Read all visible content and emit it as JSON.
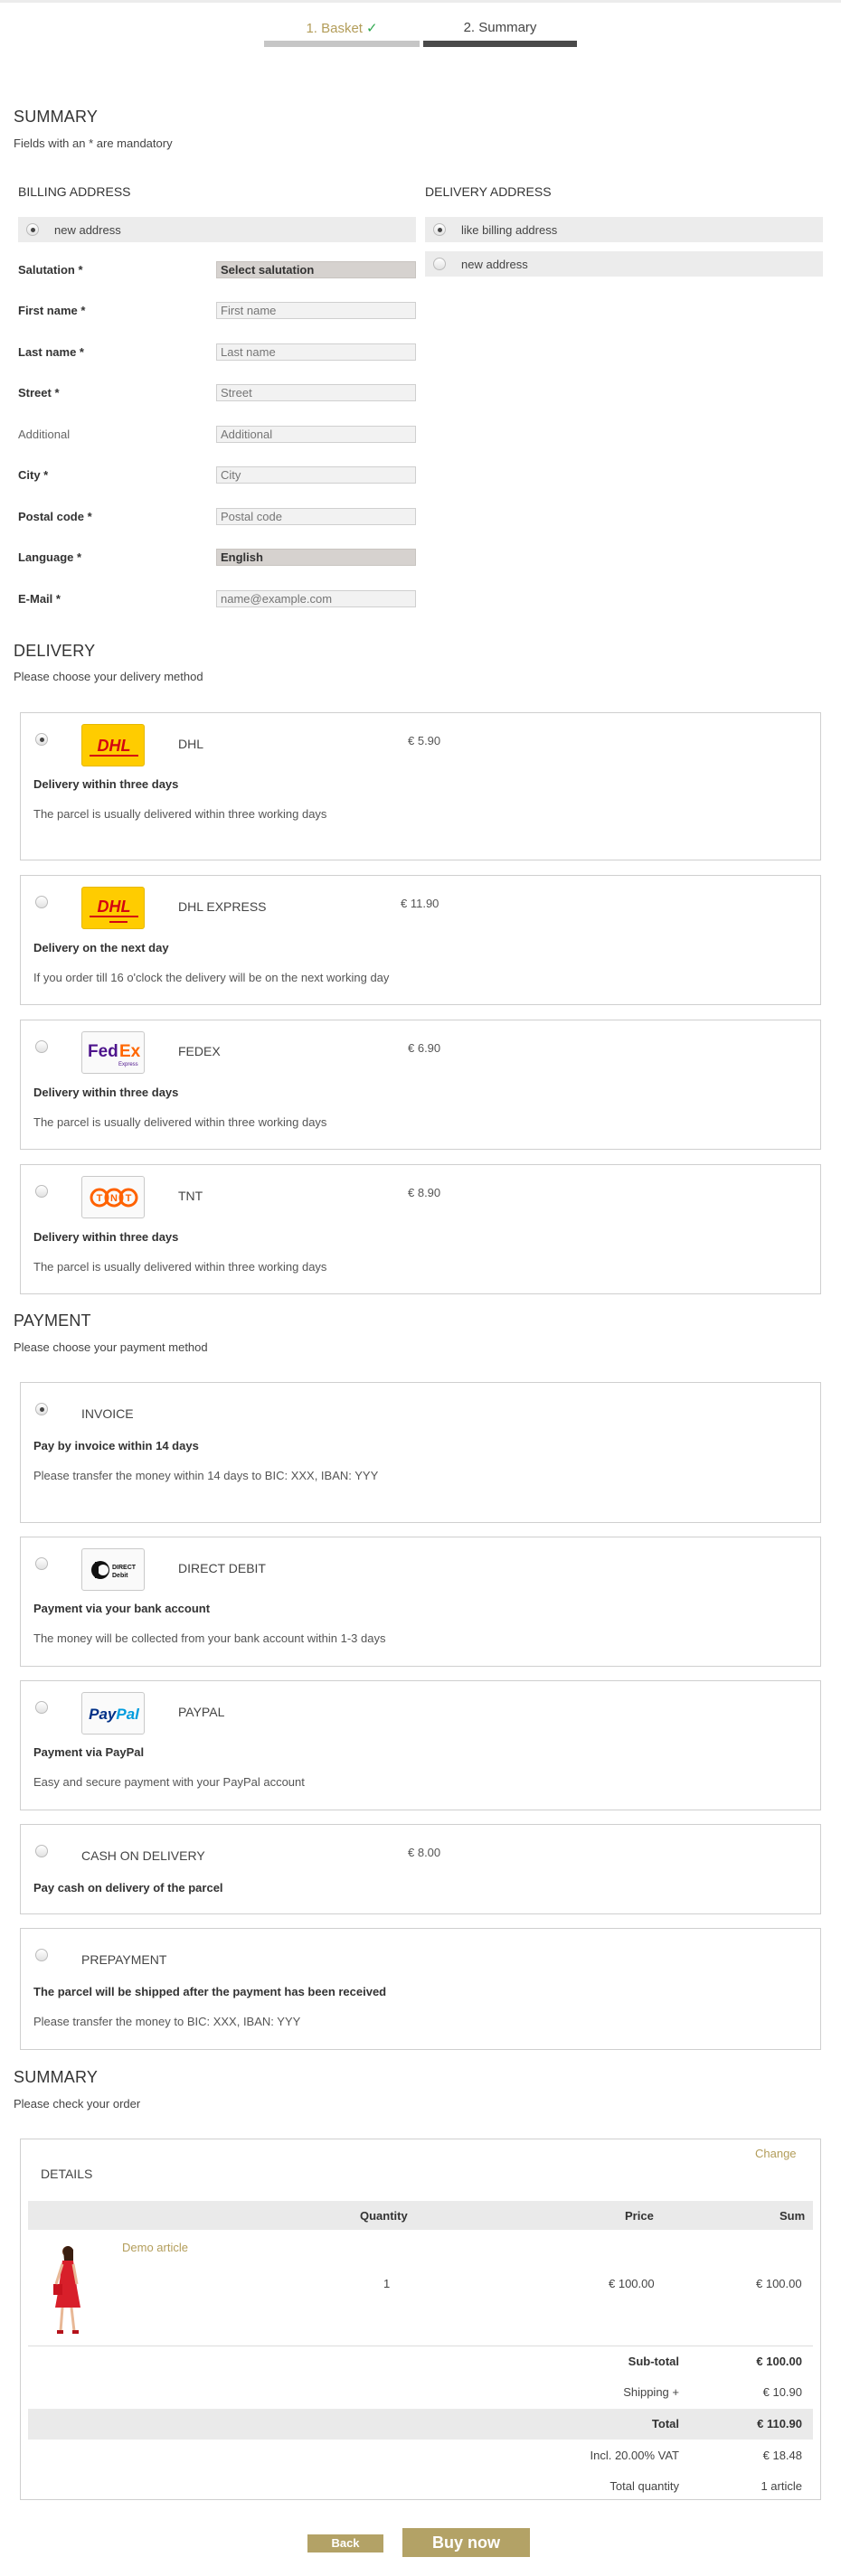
{
  "steps": {
    "basket": "1. Basket",
    "summary": "2. Summary"
  },
  "summary_header": {
    "title": "SUMMARY",
    "note": "Fields with an * are mandatory"
  },
  "billing": {
    "title": "BILLING ADDRESS",
    "option_new": "new address",
    "fields": {
      "salutation_label": "Salutation *",
      "salutation_value": "Select salutation",
      "first_label": "First name *",
      "first_ph": "First name",
      "last_label": "Last name *",
      "last_ph": "Last name",
      "street_label": "Street *",
      "street_ph": "Street",
      "additional_label": "Additional",
      "additional_ph": "Additional",
      "city_label": "City *",
      "city_ph": "City",
      "postal_label": "Postal code *",
      "postal_ph": "Postal code",
      "language_label": "Language *",
      "language_value": "English",
      "email_label": "E-Mail *",
      "email_ph": "name@example.com"
    }
  },
  "delivery_address": {
    "title": "DELIVERY ADDRESS",
    "option_like_billing": "like billing address",
    "option_new": "new address"
  },
  "delivery": {
    "title": "DELIVERY",
    "note": "Please choose your delivery method",
    "methods": [
      {
        "name": "DHL",
        "price": "€ 5.90",
        "title": "Delivery within three days",
        "desc": "The parcel is usually delivered within three working days",
        "logo": "dhl-logo",
        "logo_text": "DHL",
        "selected": true
      },
      {
        "name": "DHL EXPRESS",
        "price": "€ 11.90",
        "title": "Delivery on the next day",
        "desc": "If you order till 16 o'clock the delivery will be on the next working day",
        "logo": "dhl-express-logo",
        "logo_text": "DHL",
        "selected": false
      },
      {
        "name": "FEDEX",
        "price": "€ 6.90",
        "title": "Delivery within three days",
        "desc": "The parcel is usually delivered within three working days",
        "logo": "fedex-logo",
        "logo_text": "FedEx",
        "selected": false
      },
      {
        "name": "TNT",
        "price": "€ 8.90",
        "title": "Delivery within three days",
        "desc": "The parcel is usually delivered within three working days",
        "logo": "tnt-logo",
        "logo_text": "TNT",
        "selected": false
      }
    ]
  },
  "payment": {
    "title": "PAYMENT",
    "note": "Please choose your payment method",
    "methods": [
      {
        "name": "INVOICE",
        "price": "",
        "title": "Pay by invoice within 14 days",
        "desc": "Please transfer the money within 14 days to BIC: XXX, IBAN: YYY",
        "selected": true
      },
      {
        "name": "DIRECT DEBIT",
        "price": "",
        "title": "Payment via your bank account",
        "desc": "The money will be collected from your bank account within 1-3 days",
        "logo": "direct-debit-logo",
        "logo_text": "DIRECT DEBIT",
        "selected": false
      },
      {
        "name": "PAYPAL",
        "price": "",
        "title": "Payment via PayPal",
        "desc": "Easy and secure payment with your PayPal account",
        "logo": "paypal-logo",
        "logo_text": "PayPal",
        "selected": false
      },
      {
        "name": "CASH ON DELIVERY",
        "price": "€ 8.00",
        "title": "Pay cash on delivery of the parcel",
        "desc": "",
        "selected": false
      },
      {
        "name": "PREPAYMENT",
        "price": "",
        "title": "The parcel will be shipped after the payment has been received",
        "desc": "Please transfer the money to BIC: XXX, IBAN: YYY",
        "selected": false
      }
    ]
  },
  "order": {
    "title": "SUMMARY",
    "note": "Please check your order",
    "change": "Change",
    "details": "DETAILS",
    "headers": {
      "quantity": "Quantity",
      "price": "Price",
      "sum": "Sum"
    },
    "item": {
      "name": "Demo article",
      "quantity": "1",
      "price": "€ 100.00",
      "sum": "€ 100.00"
    },
    "totals": {
      "subtotal_label": "Sub-total",
      "subtotal": "€ 100.00",
      "shipping_label": "Shipping +",
      "shipping": "€ 10.90",
      "total_label": "Total",
      "total": "€ 110.90",
      "vat_label": "Incl. 20.00% VAT",
      "vat": "€ 18.48",
      "qty_label": "Total quantity",
      "qty": "1 article"
    }
  },
  "buttons": {
    "back": "Back",
    "buy": "Buy now"
  },
  "colors": {
    "accent": "#b3a266",
    "dhl_yellow": "#ffcc00",
    "dhl_red": "#d40511",
    "fedex_purple": "#4d148c",
    "fedex_orange": "#ff6600",
    "tnt_orange": "#ff6200",
    "paypal_blue": "#003087"
  }
}
